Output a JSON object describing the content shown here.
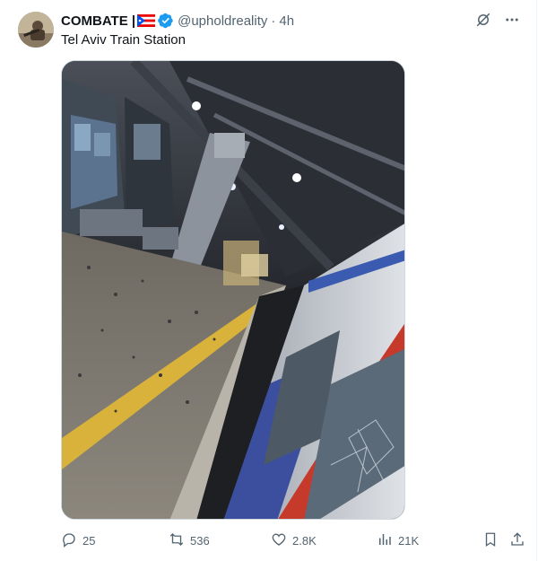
{
  "tweet": {
    "author_name": "COMBATE |",
    "handle": "@upholdreality",
    "separator": "·",
    "time": "4h",
    "text": "Tel Aviv Train Station"
  },
  "metrics": {
    "replies": "25",
    "reposts": "536",
    "likes": "2.8K",
    "views": "21K"
  },
  "colors": {
    "verified": "#1d9bf0",
    "muted_text": "#536471",
    "primary_text": "#0f1419"
  },
  "icons": [
    "grok-icon",
    "more-icon",
    "reply-icon",
    "repost-icon",
    "like-icon",
    "views-icon",
    "bookmark-icon",
    "share-icon",
    "verified-badge-icon",
    "puerto-rico-flag-icon"
  ]
}
